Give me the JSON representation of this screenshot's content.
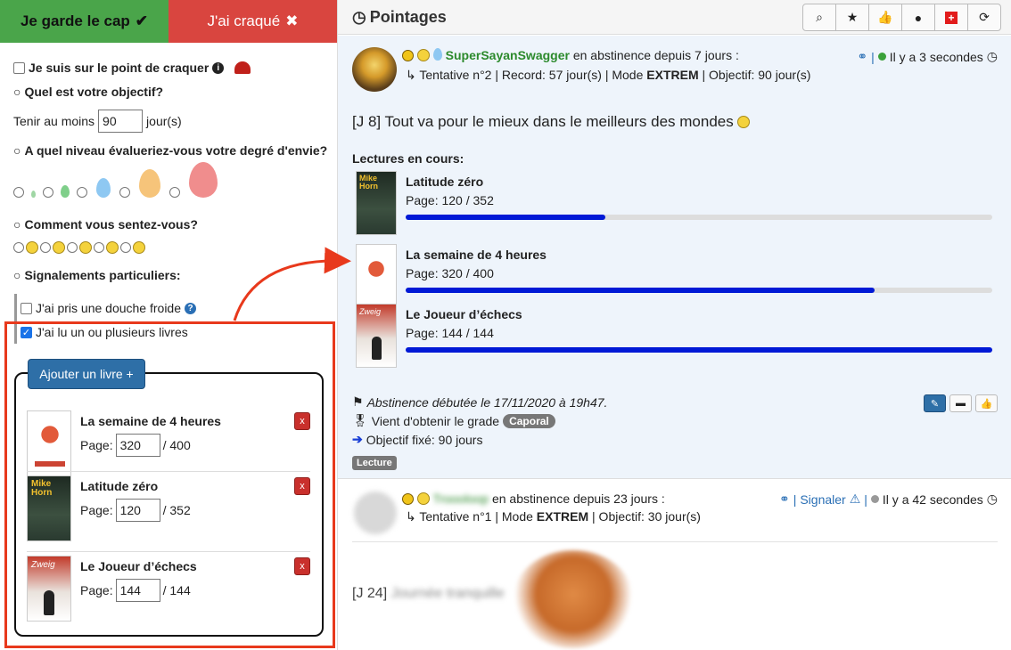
{
  "left": {
    "keep_label": "Je garde le cap",
    "crack_label": "J'ai craqué",
    "about_to_crack": "Je suis sur le point de craquer",
    "q_objective": "Quel est votre objectif?",
    "hold_at_least": "Tenir au moins",
    "objective_days": "90",
    "days_unit": "jour(s)",
    "q_craving": "A quel niveau évalueriez-vous votre degré d'envie?",
    "q_feeling": "Comment vous sentez-vous?",
    "q_special": "Signalements particuliers:",
    "cold_shower": "J'ai pris une douche froide",
    "read_books": "J'ai lu un ou plusieurs livres",
    "add_book": "Ajouter un livre +",
    "page_label": "Page:",
    "books": [
      {
        "title": "La semaine de 4 heures",
        "page": "320",
        "total": "/ 400"
      },
      {
        "title": "Latitude zéro",
        "page": "120",
        "total": "/ 352"
      },
      {
        "title": "Le Joueur d’échecs",
        "page": "144",
        "total": "/ 144"
      }
    ]
  },
  "right": {
    "title": "Pointages",
    "post1": {
      "username": "SuperSayanSwagger",
      "status": "en abstinence depuis 7 jours :",
      "details_prefix": "Tentative n°2 | Record: 57 jour(s) | Mode ",
      "mode": "EXTREM",
      "details_suffix": " | Objectif: 90 jour(s)",
      "time": "Il y a 3 secondes",
      "message": "[J 8] Tout va pour le mieux dans le meilleurs des mondes",
      "reading_header": "Lectures en cours:",
      "page_label": "Page:",
      "readings": [
        {
          "title": "Latitude zéro",
          "progress": "120 / 352",
          "fraction": 0.341
        },
        {
          "title": "La semaine de 4 heures",
          "progress": "320 / 400",
          "fraction": 0.8
        },
        {
          "title": "Le Joueur d’échecs",
          "progress": "144 / 144",
          "fraction": 1.0
        }
      ],
      "started": "Abstinence débutée le 17/11/2020 à 19h47.",
      "grade_text": "Vient d'obtenir le grade",
      "grade": "Caporal",
      "objective_text": "Objectif fixé: 90 jours",
      "tag": "Lecture"
    },
    "post2": {
      "username": "Troooloop",
      "status": "en abstinence depuis 23 jours :",
      "details_prefix": "Tentative n°1 | Mode ",
      "mode": "EXTREM",
      "details_suffix": " | Objectif: 30 jour(s)",
      "report": "Signaler",
      "time": "Il y a 42 secondes",
      "day_label": "[J 24]",
      "message_blurred": "Journée tranquille"
    }
  },
  "colors": {
    "keep": "#4aa54a",
    "crack": "#d9453f",
    "progress": "#0019d6",
    "highlight": "#e8391c",
    "username": "#2c8a2c"
  }
}
